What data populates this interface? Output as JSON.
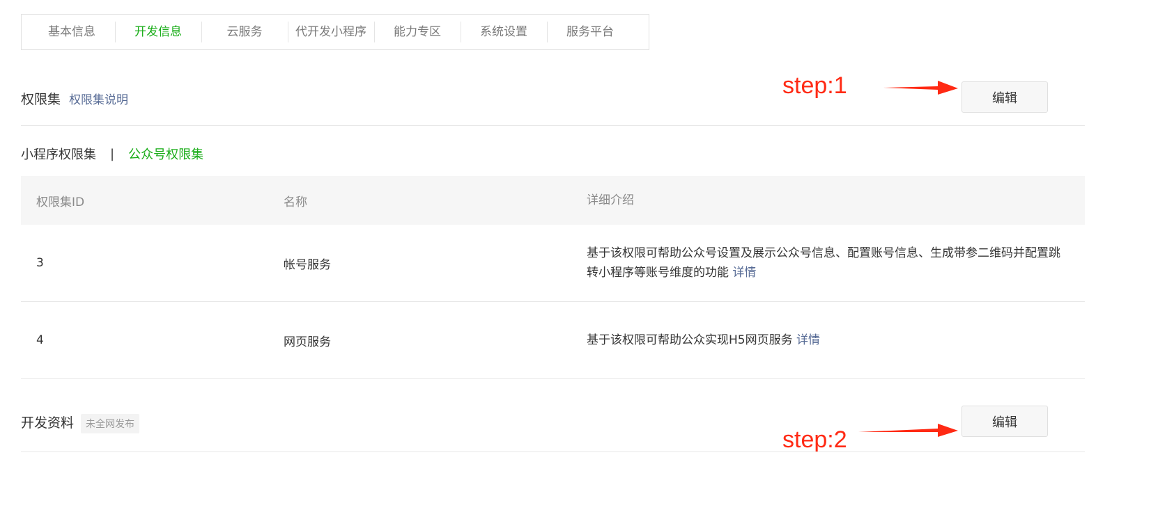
{
  "tabs": [
    {
      "label": "基本信息",
      "active": false
    },
    {
      "label": "开发信息",
      "active": true
    },
    {
      "label": "云服务",
      "active": false
    },
    {
      "label": "代开发小程序",
      "active": false
    },
    {
      "label": "能力专区",
      "active": false
    },
    {
      "label": "系统设置",
      "active": false
    },
    {
      "label": "服务平台",
      "active": false
    }
  ],
  "permissions": {
    "title": "权限集",
    "help_link": "权限集说明",
    "edit_label": "编辑",
    "subtabs": {
      "mini_program": "小程序权限集",
      "separator": "|",
      "official": "公众号权限集"
    },
    "table": {
      "headers": [
        "权限集ID",
        "名称",
        "详细介绍"
      ],
      "rows": [
        {
          "id": "3",
          "name": "帐号服务",
          "desc": "基于该权限可帮助公众号设置及展示公众号信息、配置账号信息、生成带参二维码并配置跳转小程序等账号维度的功能",
          "link": "详情"
        },
        {
          "id": "4",
          "name": "网页服务",
          "desc": "基于该权限可帮助公众实现H5网页服务",
          "link": "详情"
        }
      ]
    }
  },
  "dev_materials": {
    "title": "开发资料",
    "badge": "未全网发布",
    "edit_label": "编辑"
  },
  "annotations": {
    "step1": "step:1",
    "step2": "step:2",
    "color": "#ff2a14"
  }
}
